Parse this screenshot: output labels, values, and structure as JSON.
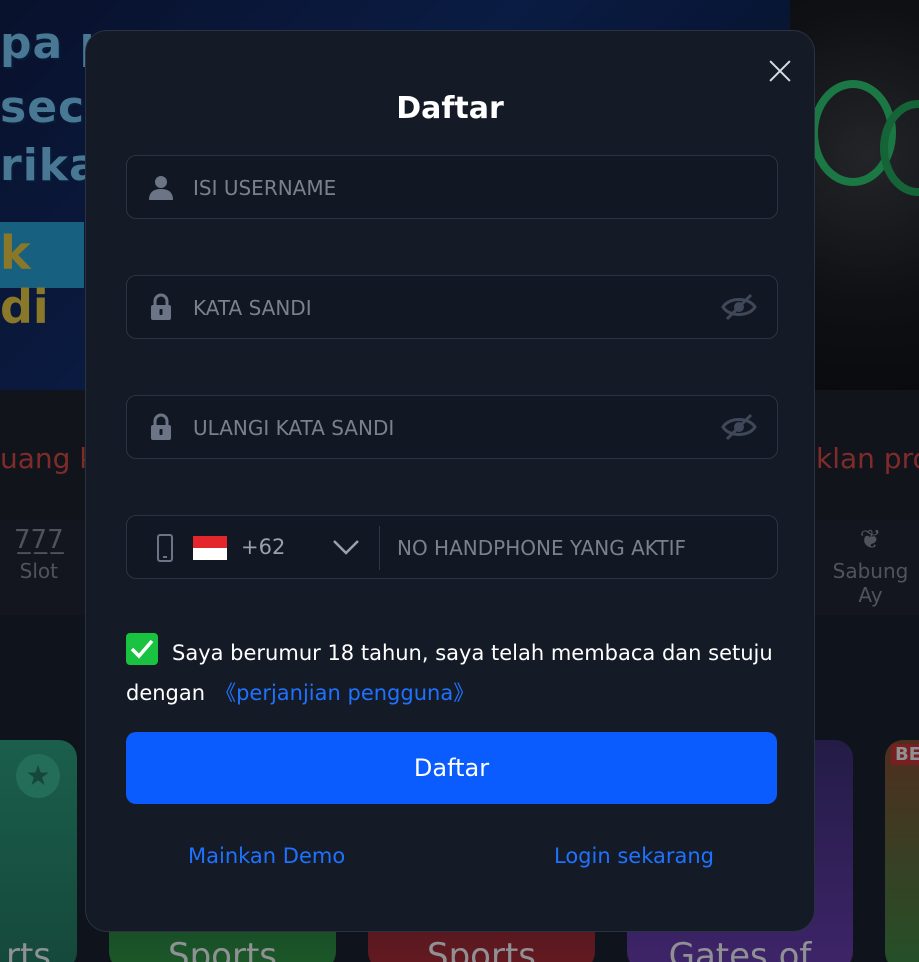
{
  "background": {
    "banner_lines": [
      "pa pe",
      "secar",
      "rikan",
      "k di"
    ],
    "marquee_left": "uang ke",
    "marquee_right": "klan pro",
    "categories": [
      {
        "label": "Slot",
        "icon": "slot-777-icon"
      },
      {
        "label": "Sabung Ay",
        "icon": "rooster-icon"
      }
    ],
    "game_labels": [
      "rts",
      "Sports",
      "Sports",
      "Gates of",
      "BES"
    ]
  },
  "modal": {
    "title": "Daftar",
    "username": {
      "placeholder": "ISI USERNAME",
      "value": ""
    },
    "password": {
      "placeholder": "KATA SANDI",
      "value": ""
    },
    "confirm_password": {
      "placeholder": "ULANGI KATA SANDI",
      "value": ""
    },
    "phone": {
      "country_code": "+62",
      "placeholder": "NO HANDPHONE YANG AKTIF",
      "value": ""
    },
    "agreement": {
      "checked": true,
      "text": "Saya berumur 18 tahun, saya telah membaca dan setuju dengan",
      "link": "《perjanjian pengguna》"
    },
    "submit_label": "Daftar",
    "demo_link": "Mainkan Demo",
    "login_link": "Login sekarang"
  },
  "colors": {
    "modal_bg": "#151b26",
    "accent_blue": "#0a5cff",
    "link_blue": "#1e72ff",
    "checkbox_green": "#19c240",
    "marquee_red": "#e0453d"
  }
}
